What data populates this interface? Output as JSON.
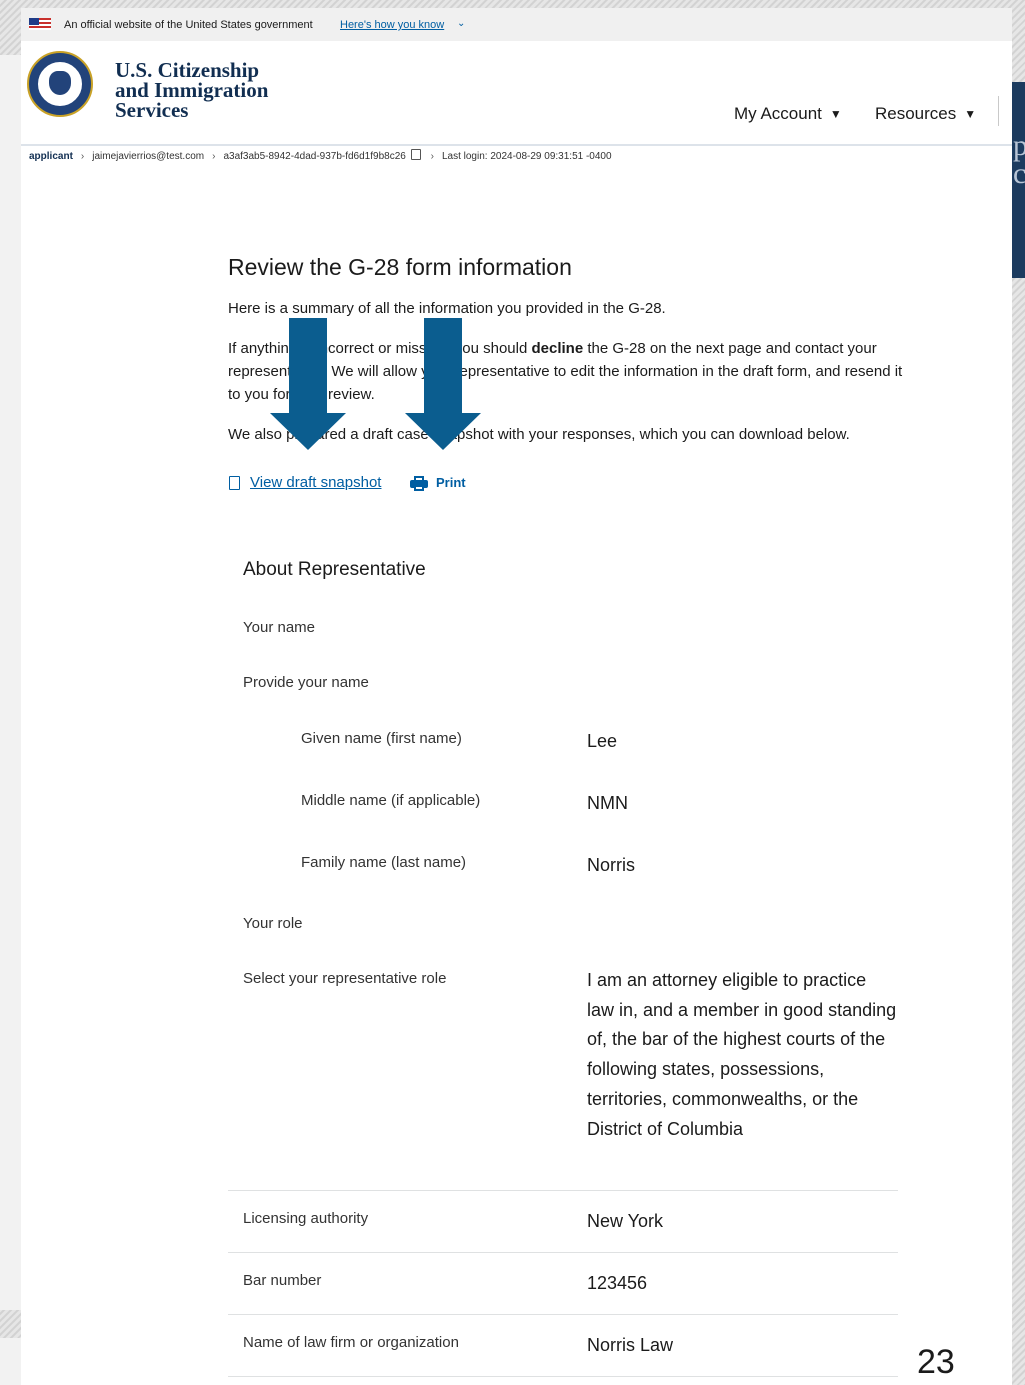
{
  "gov_banner": {
    "text": "An official website of the United States government",
    "link": "Here's how you know",
    "chevron": "⌄"
  },
  "header": {
    "agency_line1": "U.S. Citizenship",
    "agency_line2": "and Immigration",
    "agency_line3": "Services",
    "nav": [
      {
        "label": "My Account",
        "caret": "▼"
      },
      {
        "label": "Resources",
        "caret": "▼"
      }
    ]
  },
  "breadcrumb": {
    "role": "applicant",
    "email": "jaimejavierrios@test.com",
    "id": "a3af3ab5-8942-4dad-937b-fd6d1f9b8c26",
    "last_login": "Last login: 2024-08-29 09:31:51 -0400",
    "sep": "›"
  },
  "main": {
    "title": "Review the G-28 form information",
    "intro": "Here is a summary of all the information you provided in the G-28.",
    "p2_a": "If anything is incorrect or missing, you should ",
    "p2_bold": "decline",
    "p2_b": " the G-28 on the next page and contact your representative. We will allow your representative to edit the information in the draft form, and resend it to you for your review.",
    "p3": "We also prepared a draft case snapshot with your responses, which you can download below.",
    "view_snapshot": "View draft snapshot",
    "print": "Print"
  },
  "section": {
    "title": "About Representative",
    "your_name": "Your name",
    "provide_name": "Provide your name",
    "given_label": "Given name (first name)",
    "given_value": "Lee",
    "middle_label": "Middle name (if applicable)",
    "middle_value": "NMN",
    "family_label": "Family name (last name)",
    "family_value": "Norris",
    "your_role": "Your role",
    "role_label": "Select your representative role",
    "role_value": "I am an attorney eligible to practice law in, and a member in good standing of, the bar of the highest courts of the following states, possessions, territories, commonwealths, or the District of Columbia",
    "licensing_label": "Licensing authority",
    "licensing_value": "New York",
    "bar_label": "Bar number",
    "bar_value": "123456",
    "firm_label": "Name of law firm or organization",
    "firm_value": "Norris Law"
  },
  "slide_number": "23",
  "colors": {
    "link": "#005ea2",
    "arrow": "#0b5d8f",
    "agency": "#112e51"
  },
  "icons": [
    "flag-icon",
    "seal-icon",
    "copy-icon",
    "pdf-icon",
    "print-icon",
    "down-arrow-annotation"
  ]
}
